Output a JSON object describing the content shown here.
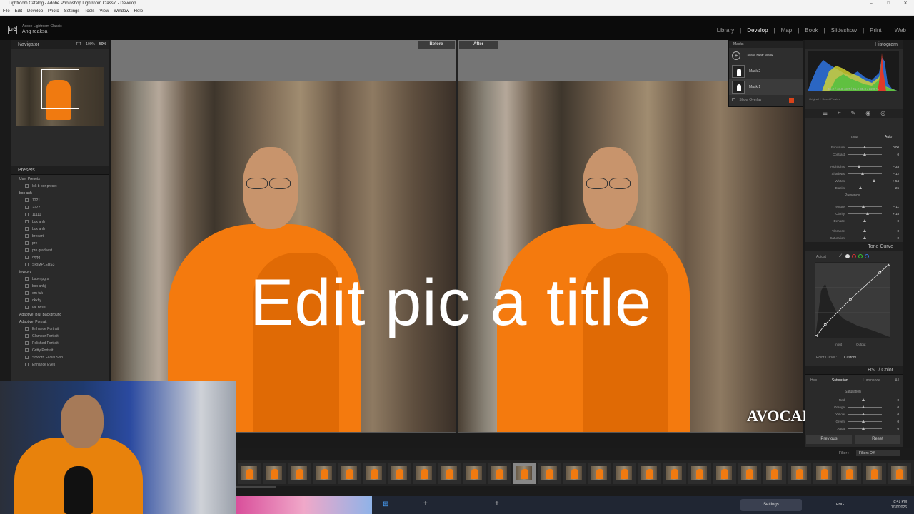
{
  "window": {
    "title": "Lightroom Catalog - Adobe Photoshop Lightroom Classic - Develop",
    "minimize": "–",
    "maximize": "□",
    "close": "✕"
  },
  "menu": [
    "File",
    "Edit",
    "Develop",
    "Photo",
    "Settings",
    "Tools",
    "View",
    "Window",
    "Help"
  ],
  "identity": {
    "logo": "LrC",
    "app": "Adobe Lightroom Classic",
    "user": "Ang reaksa"
  },
  "modules": [
    "Library",
    "Develop",
    "Map",
    "Book",
    "Slideshow",
    "Print",
    "Web"
  ],
  "navigator": {
    "label": "Navigator",
    "fit": "FIT",
    "fill": "100%",
    "zoom": "50%"
  },
  "presets": {
    "label": "Presets",
    "groups": [
      {
        "name": "User Presets",
        "items": [
          "lok b por preset"
        ]
      },
      {
        "name": "box anh",
        "items": [
          "1221",
          "2222",
          "11111",
          "box anh",
          "box anh",
          "breeart",
          "pre",
          "pre graduest",
          "qqqq",
          "SRIMPLEBS3"
        ]
      },
      {
        "name": "tevvuvv",
        "items": [
          "bsbvnpgrs",
          "box anhj",
          "om tuk",
          "dkkhy",
          "val bhse"
        ]
      },
      {
        "name": "Adaptive: Blur Background",
        "items": []
      },
      {
        "name": "Adaptive: Portrait",
        "items": [
          "Enhance Portrait",
          "Glamour Portrait",
          "Polished Portrait",
          "Gritty Portrait",
          "Smooth Facial Skin",
          "Enhance Eyes"
        ]
      }
    ]
  },
  "view": {
    "before": "Before",
    "after": "After"
  },
  "overlay_title": "Edit pic a title",
  "watermark": "AVOCADO",
  "masks": {
    "label": "Masks",
    "create": "Create New Mask",
    "items": [
      "Mask 2",
      "Mask 1"
    ],
    "show_overlay": "Show Overlay"
  },
  "histogram": {
    "label": "Histogram",
    "readout": "46.2 / 43.8   43.7 / 41.2   35.0 / 32.0 %",
    "preview": "Original + Smart Preview"
  },
  "basic": {
    "tone": "Tone",
    "auto": "Auto",
    "presence": "Presence",
    "sliders": [
      {
        "label": "Exposure",
        "value": "0.00",
        "pos": 0.5
      },
      {
        "label": "Contrast",
        "value": "0",
        "pos": 0.5
      },
      {
        "label": "Highlights",
        "value": "– 33",
        "pos": 0.34
      },
      {
        "label": "Shadows",
        "value": "– 12",
        "pos": 0.44
      },
      {
        "label": "Whites",
        "value": "+ 54",
        "pos": 0.77
      },
      {
        "label": "Blacks",
        "value": "– 26",
        "pos": 0.37
      },
      {
        "label": "Texture",
        "value": "– 11",
        "pos": 0.45
      },
      {
        "label": "Clarity",
        "value": "+ 18",
        "pos": 0.59
      },
      {
        "label": "Dehaze",
        "value": "0",
        "pos": 0.5
      },
      {
        "label": "Vibrance",
        "value": "0",
        "pos": 0.5
      },
      {
        "label": "Saturation",
        "value": "0",
        "pos": 0.5
      }
    ]
  },
  "tone_curve": {
    "label": "Tone Curve",
    "adjust": "Adjust",
    "input": "Input",
    "output": "Output",
    "point_curve_label": "Point Curve :",
    "point_curve": "Custom"
  },
  "hsl": {
    "label": "HSL / Color",
    "tabs": [
      "Hue",
      "Saturation",
      "Luminance",
      "All"
    ],
    "section": "Saturation",
    "sliders": [
      {
        "label": "Red",
        "value": "0"
      },
      {
        "label": "Orange",
        "value": "0"
      },
      {
        "label": "Yellow",
        "value": "0"
      },
      {
        "label": "Green",
        "value": "0"
      },
      {
        "label": "Aqua",
        "value": "0"
      }
    ]
  },
  "buttons": {
    "previous": "Previous",
    "reset": "Reset"
  },
  "filmstrip": {
    "filter_label": "Filter :",
    "filter_value": "Filters Off",
    "count": 27,
    "selected_index": 11
  },
  "taskbar": {
    "settings": "Settings",
    "lang": "ENG",
    "time": "8:41 PM",
    "date": "1/30/2026"
  }
}
